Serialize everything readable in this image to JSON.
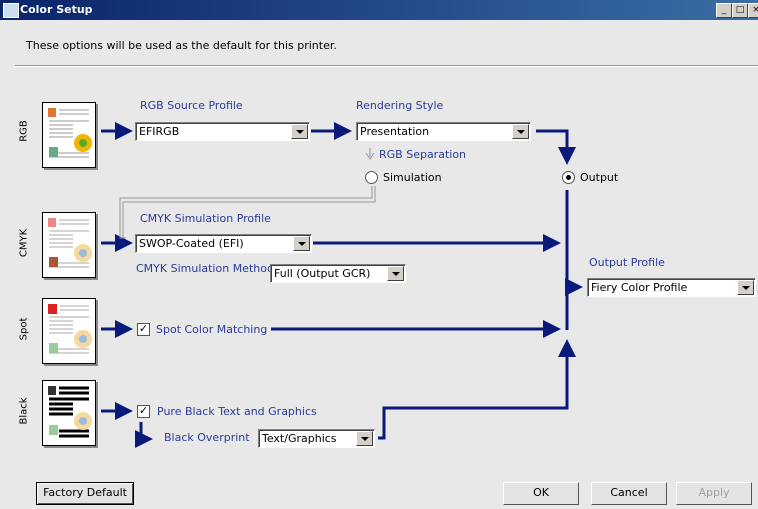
{
  "window": {
    "title": "Color Setup",
    "buttons": {
      "minimize": "_",
      "maximize": "□",
      "close": "×"
    }
  },
  "description": "These options will be used as the default for this printer.",
  "rows": {
    "rgb": "RGB",
    "cmyk": "CMYK",
    "spot": "Spot",
    "black": "Black"
  },
  "rgb": {
    "source_label": "RGB Source Profile",
    "source_value": "EFIRGB",
    "rendering_label": "Rendering Style",
    "rendering_value": "Presentation",
    "separation_label": "RGB Separation",
    "simulation_label": "Simulation",
    "output_label": "Output"
  },
  "cmyk": {
    "profile_label": "CMYK Simulation Profile",
    "profile_value": "SWOP-Coated (EFI)",
    "method_label": "CMYK Simulation Method",
    "method_value": "Full (Output GCR)"
  },
  "output": {
    "label": "Output Profile",
    "value": "Fiery Color Profile"
  },
  "spot": {
    "label": "Spot Color Matching",
    "checked": true
  },
  "black": {
    "pure_label": "Pure Black Text and Graphics",
    "pure_checked": true,
    "overprint_label": "Black Overprint",
    "overprint_value": "Text/Graphics"
  },
  "footer": {
    "factory_default": "Factory Default",
    "ok": "OK",
    "cancel": "Cancel",
    "apply": "Apply"
  },
  "colors": {
    "flow": "#0a1a7a",
    "label_blue": "#2a3a9a",
    "title_bar": "#0a246a"
  }
}
